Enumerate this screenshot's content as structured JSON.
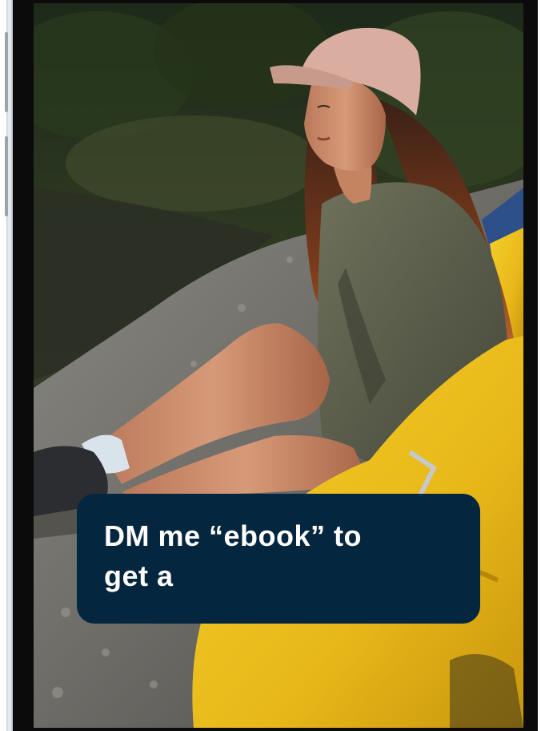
{
  "story": {
    "photo_subject": "woman-in-cap-sitting-by-river-with-yellow-backpack",
    "caption": "DM me “ebook” to\nget a"
  },
  "colors": {
    "caption_background": "#04273f",
    "caption_text": "#ffffff",
    "bezel": "#0b0b0c",
    "backpack_yellow": "#f0c51c",
    "cap_pink": "#d9aea0",
    "jacket_olive": "#5b5e48"
  }
}
